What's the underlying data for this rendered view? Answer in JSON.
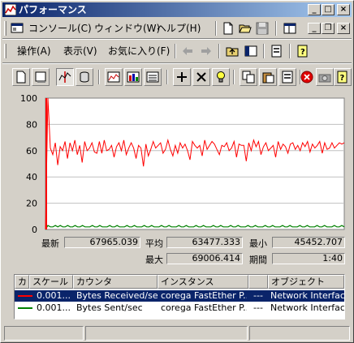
{
  "window": {
    "title": "パフォーマンス",
    "min_glyph": "_",
    "max_glyph": "□",
    "close_glyph": "×"
  },
  "menu": {
    "items": [
      {
        "id": "console",
        "label": "コンソール(C)"
      },
      {
        "id": "window",
        "label": "ウィンドウ(W)"
      },
      {
        "id": "help",
        "label": "ヘルプ(H)"
      }
    ]
  },
  "console_toolbar": {
    "items": [
      {
        "id": "action",
        "label": "操作(A)"
      },
      {
        "id": "view",
        "label": "表示(V)"
      },
      {
        "id": "favorites",
        "label": "お気に入り(F)"
      }
    ]
  },
  "chart_data": {
    "type": "line",
    "ylim": [
      0,
      100
    ],
    "yticks": [
      "100",
      "80",
      "60",
      "40",
      "20",
      "0"
    ],
    "series": [
      {
        "name": "Bytes Received/sec",
        "color": "#ff0000",
        "values": [
          0,
          100,
          62,
          57,
          66,
          49,
          63,
          60,
          67,
          54,
          66,
          60,
          68,
          57,
          64,
          51,
          67,
          60,
          62,
          66,
          59,
          58,
          67,
          58,
          68,
          60,
          61,
          64,
          55,
          63,
          66,
          60,
          68,
          57,
          62,
          66,
          62,
          54,
          64,
          62,
          48,
          65,
          56,
          61,
          67,
          62,
          64,
          66,
          58,
          61,
          68,
          61,
          56,
          64,
          58,
          66,
          62,
          65,
          60,
          53,
          67,
          64,
          62,
          64,
          56,
          68,
          61,
          64,
          67,
          65,
          61,
          57,
          64,
          63,
          66,
          60,
          62,
          67,
          55,
          65,
          64,
          64,
          52,
          66,
          60,
          68,
          63,
          67,
          57,
          63,
          66,
          60,
          62,
          64,
          55,
          67,
          61,
          65,
          63,
          58,
          65,
          66,
          61,
          64,
          60,
          66,
          63,
          67,
          59,
          65,
          62,
          64,
          67,
          58,
          66,
          61,
          62,
          66,
          62,
          64,
          66,
          65,
          66
        ]
      },
      {
        "name": "Bytes Sent/sec",
        "color": "#008000",
        "values": [
          0,
          3,
          2,
          2,
          3,
          2,
          3,
          2,
          2,
          3,
          2,
          2,
          3,
          2,
          2,
          3,
          2,
          2,
          2,
          3,
          2,
          2,
          3,
          2,
          2,
          2,
          3,
          2,
          2,
          3,
          2,
          2,
          2,
          3,
          2,
          2,
          3,
          2,
          2,
          2,
          3,
          2,
          2,
          3,
          2,
          2,
          2,
          3,
          2,
          2,
          3,
          2,
          2,
          2,
          3,
          2,
          2,
          3,
          2,
          2,
          2,
          3,
          2,
          2,
          3,
          2,
          2,
          2,
          3,
          2,
          2,
          3,
          2,
          2,
          2,
          3,
          2,
          2,
          3,
          2,
          2,
          2,
          3,
          2,
          2,
          3,
          2,
          2,
          2,
          3,
          2,
          2,
          3,
          2,
          2,
          2,
          3,
          2,
          2,
          3,
          2,
          2,
          2,
          3,
          2,
          2,
          3,
          2,
          2,
          2,
          3,
          2,
          2,
          3,
          2,
          2,
          2,
          3,
          2,
          2,
          3,
          2
        ]
      }
    ]
  },
  "stats": {
    "last_label": "最新",
    "last_value": "67965.039",
    "avg_label": "平均",
    "avg_value": "63477.333",
    "min_label": "最小",
    "min_value": "45452.707",
    "max_label": "最大",
    "max_value": "69006.414",
    "duration_label": "期間",
    "duration_value": "1:40"
  },
  "counter_list": {
    "headers": [
      "カ",
      "スケール",
      "カウンタ",
      "インスタンス",
      "",
      "オブジェクト"
    ],
    "rows": [
      {
        "color": "#ff0000",
        "scale": "0.001...",
        "counter": "Bytes Received/sec",
        "instance": "corega FastEther P...",
        "parent": "---",
        "object": "Network Interface",
        "selected": true
      },
      {
        "color": "#008000",
        "scale": "0.001...",
        "counter": "Bytes Sent/sec",
        "instance": "corega FastEther P...",
        "parent": "---",
        "object": "Network Interface",
        "selected": false
      }
    ]
  }
}
